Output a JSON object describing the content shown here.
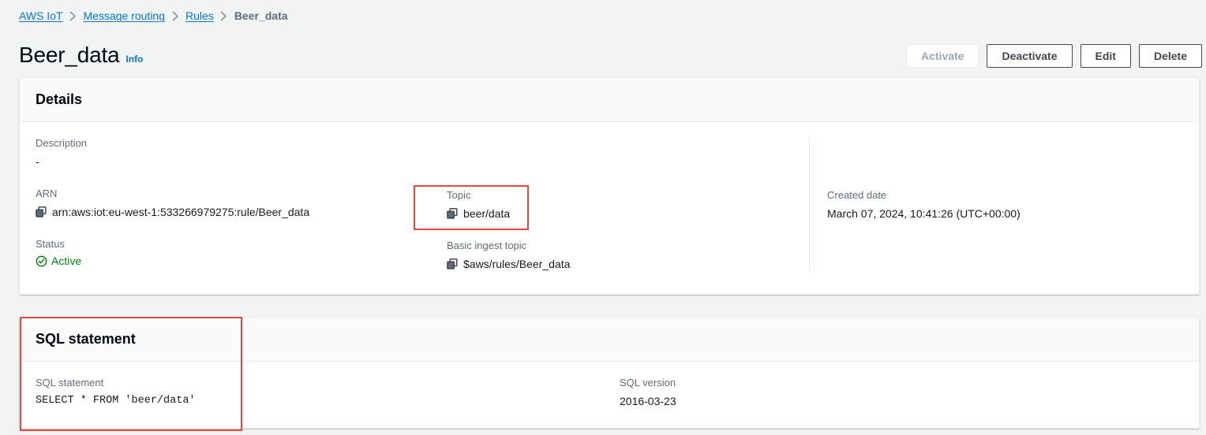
{
  "breadcrumb": {
    "items": [
      {
        "label": "AWS IoT",
        "type": "link"
      },
      {
        "label": "Message routing",
        "type": "link"
      },
      {
        "label": "Rules",
        "type": "link"
      },
      {
        "label": "Beer_data",
        "type": "current"
      }
    ]
  },
  "header": {
    "title": "Beer_data",
    "info_label": "Info",
    "actions": [
      {
        "label": "Activate",
        "disabled": true
      },
      {
        "label": "Deactivate",
        "disabled": false
      },
      {
        "label": "Edit",
        "disabled": false
      },
      {
        "label": "Delete",
        "disabled": false
      }
    ]
  },
  "details": {
    "section_title": "Details",
    "description": {
      "label": "Description",
      "value": "-"
    },
    "arn": {
      "label": "ARN",
      "value": "arn:aws:iot:eu-west-1:533266979275:rule/Beer_data",
      "icon": "copy-icon"
    },
    "status": {
      "label": "Status",
      "value": "Active",
      "icon": "status-check-icon",
      "color": "#037f0c"
    },
    "topic": {
      "label": "Topic",
      "value": "beer/data",
      "icon": "copy-icon",
      "highlighted": true
    },
    "basic_ingest_topic": {
      "label": "Basic ingest topic",
      "value": "$aws/rules/Beer_data",
      "icon": "copy-icon"
    },
    "created_date": {
      "label": "Created date",
      "value": "March 07, 2024, 10:41:26 (UTC+00:00)"
    }
  },
  "sql": {
    "section_title": "SQL statement",
    "statement": {
      "label": "SQL statement",
      "value": "SELECT * FROM 'beer/data'"
    },
    "version": {
      "label": "SQL version",
      "value": "2016-03-23"
    }
  },
  "annotations": {
    "highlight_color": "#e8453c",
    "boxes": [
      {
        "name": "topic-highlight"
      },
      {
        "name": "sql-statement-highlight"
      }
    ]
  }
}
